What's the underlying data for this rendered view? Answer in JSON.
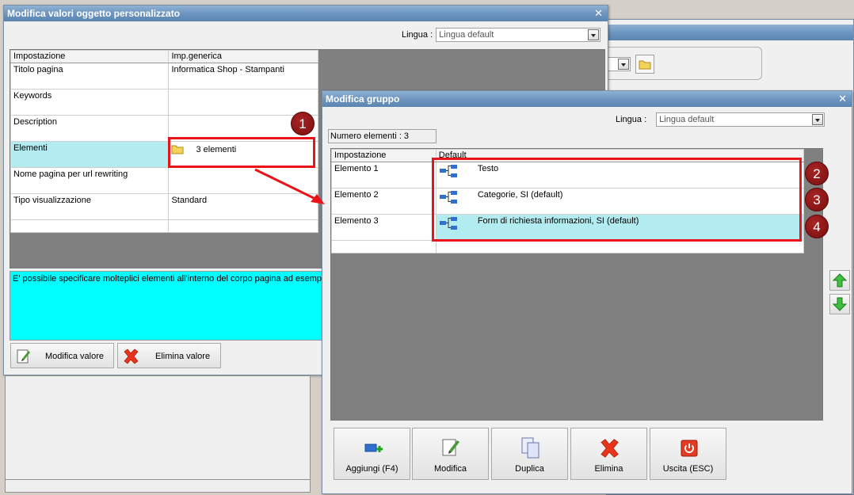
{
  "win_main": {
    "title": "Modifica valori oggetto personalizzato",
    "lang_label": "Lingua :",
    "lang_value": "Lingua default",
    "col_setting": "Impostazione",
    "col_generic": "Imp.generica",
    "rows": [
      {
        "label": "Titolo pagina",
        "value": "Informatica Shop - Stampanti"
      },
      {
        "label": "Keywords",
        "value": ""
      },
      {
        "label": "Description",
        "value": ""
      },
      {
        "label": "Elementi",
        "value": "3 elementi"
      },
      {
        "label": "Nome pagina per url rewriting",
        "value": ""
      },
      {
        "label": "Tipo visualizzazione",
        "value": "Standard"
      }
    ],
    "info": "E' possibile specificare molteplici elementi all'interno del corpo pagina ad esempio un",
    "btn_edit": "Modifica valore",
    "btn_delete": "Elimina valore"
  },
  "win_group": {
    "title": "Modifica gruppo",
    "lang_label": "Lingua :",
    "lang_value": "Lingua default",
    "count": "Numero elementi : 3",
    "col_setting": "Impostazione",
    "col_default": "Default",
    "rows": [
      {
        "label": "Elemento 1",
        "value": "Testo"
      },
      {
        "label": "Elemento 2",
        "value": "Categorie, SI (default)"
      },
      {
        "label": "Elemento 3",
        "value": "Form di richiesta informazioni, SI (default)"
      }
    ],
    "buttons": {
      "add": "Aggiungi (F4)",
      "edit": "Modifica",
      "duplicate": "Duplica",
      "delete": "Elimina",
      "exit": "Uscita (ESC)"
    }
  },
  "badges": [
    "1",
    "2",
    "3",
    "4"
  ],
  "colors": {
    "highlight_red": "#e8141a",
    "selection": "#b3ecf0",
    "info_bg": "#00ffff"
  }
}
